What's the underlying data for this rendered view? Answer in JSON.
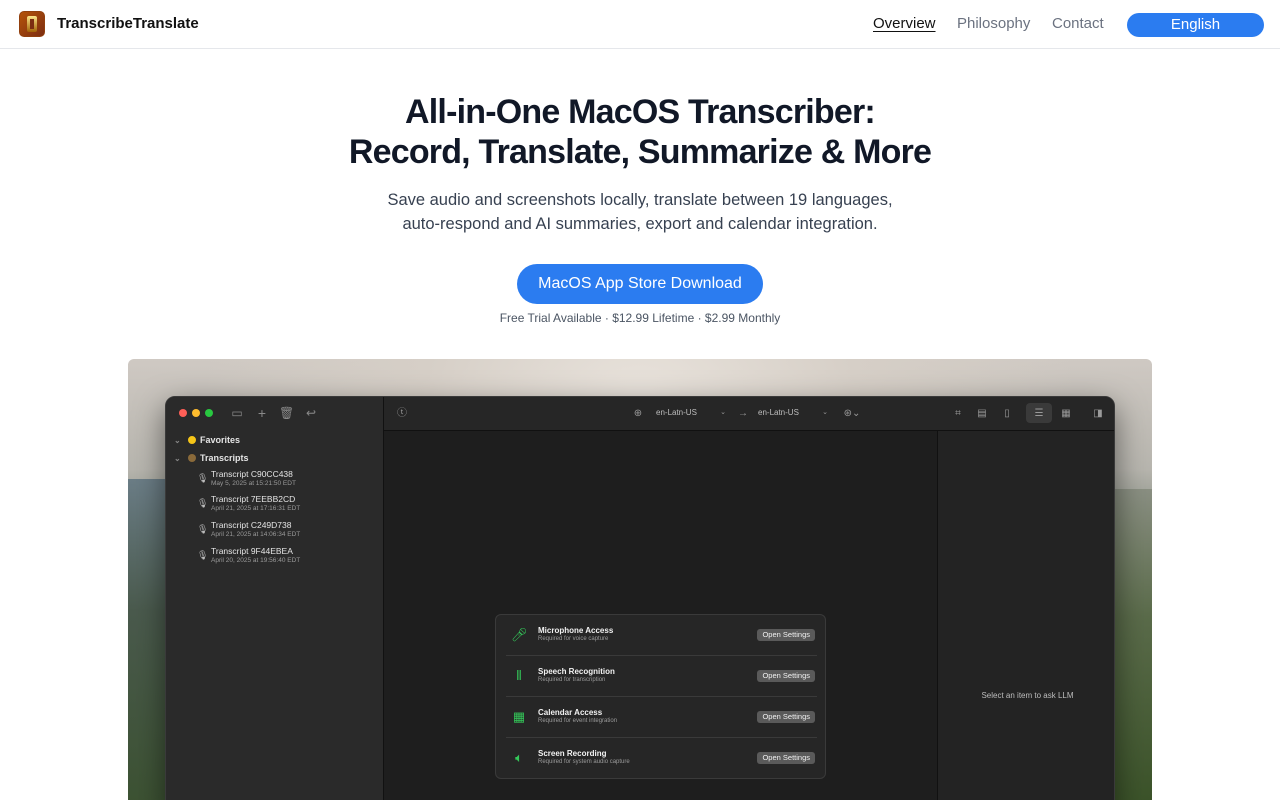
{
  "nav": {
    "brand": "TranscribeTranslate",
    "links": [
      "Overview",
      "Philosophy",
      "Contact"
    ],
    "language": "English"
  },
  "hero": {
    "title_line1": "All-in-One MacOS Transcriber:",
    "title_line2": "Record, Translate, Summarize & More",
    "subtitle_line1": "Save audio and screenshots locally, translate between 19 languages,",
    "subtitle_line2": "auto-respond and AI summaries, export and calendar integration.",
    "cta": "MacOS App Store Download",
    "pricing": "Free Trial Available · $12.99 Lifetime · $2.99 Monthly"
  },
  "app": {
    "sidebar": {
      "favorites": "Favorites",
      "transcripts": "Transcripts",
      "items": [
        {
          "name": "Transcript C90CC438",
          "date": "May 5, 2025 at 15:21:50 EDT"
        },
        {
          "name": "Transcript 7EEBB2CD",
          "date": "April 21, 2025 at 17:16:31 EDT"
        },
        {
          "name": "Transcript C249D738",
          "date": "April 21, 2025 at 14:06:34 EDT"
        },
        {
          "name": "Transcript 9F44EBEA",
          "date": "April 20, 2025 at 19:56:40 EDT"
        }
      ]
    },
    "toolbar": {
      "source_lang": "en-Latn-US",
      "target_lang": "en-Latn-US"
    },
    "permissions": [
      {
        "title": "Microphone Access",
        "desc": "Required for voice capture",
        "button": "Open Settings",
        "icon": "microphone-icon"
      },
      {
        "title": "Speech Recognition",
        "desc": "Required for transcription",
        "button": "Open Settings",
        "icon": "waveform-icon"
      },
      {
        "title": "Calendar Access",
        "desc": "Required for event integration",
        "button": "Open Settings",
        "icon": "calendar-icon"
      },
      {
        "title": "Screen Recording",
        "desc": "Required for system audio capture",
        "button": "Open Settings",
        "icon": "speaker-icon"
      }
    ],
    "right_panel": "Select an item to ask LLM"
  },
  "colors": {
    "accent": "#2b7cf0",
    "success": "#34c759"
  }
}
